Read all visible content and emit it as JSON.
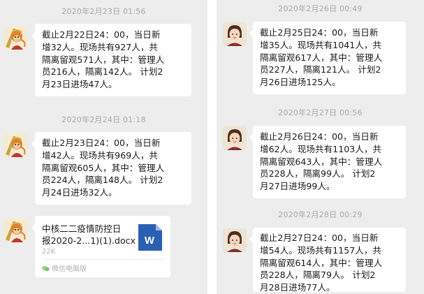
{
  "colors": {
    "chat_background": "#ededed",
    "bubble": "#ffffff",
    "timestamp_text": "#a8a8a8",
    "word_icon": "#2b5fb3"
  },
  "left_panel": {
    "messages": [
      {
        "timestamp": "2020年2月23日 01:56",
        "lines": [
          "截止2月22日24：00，当日新",
          "增32人。现场共有927人，共",
          "隔离留观571人，其中：管理人",
          "员216人，隔离142人。 计划2",
          "月23日进场47人。"
        ],
        "avatar_icon": "monkey-king-avatar-icon"
      },
      {
        "timestamp": "2020年2月24日 01:18",
        "lines": [
          "截止2月23日24：00，当日新",
          "增42人。现场共有969人，共",
          "隔离留观605人，其中：管理人",
          "员224人，隔离148人。 计划2",
          "月24日进场32人。"
        ],
        "avatar_icon": "monkey-king-avatar-icon"
      }
    ],
    "file_message": {
      "avatar_icon": "monkey-king-avatar-icon",
      "name_line1": "中核二二疫情防控日",
      "name_line2": "报2020-2...1)(1).docx",
      "size": "22K",
      "source": "微信电脑版",
      "file_icon": "word-document-icon",
      "icon_letter": "W"
    }
  },
  "right_panel": {
    "messages": [
      {
        "timestamp": "2020年2月26日 00:49",
        "lines": [
          "截止2月25日24：00，当日新",
          "增35人。现场共有1041人，共",
          "隔离留观617人，其中：管理人",
          "员227人，隔离121人。 计划2",
          "月26日进场125人。"
        ],
        "avatar_icon": "cartoon-woman-avatar-icon"
      },
      {
        "timestamp": "2020年2月27日 00:56",
        "lines": [
          "截止2月26日24：00，当日新",
          "增62人。现场共有1103人，共",
          "隔离留观643人，其中：管理人",
          "员228人，隔离99人。 计划2",
          "月27日进场99人。"
        ],
        "avatar_icon": "cartoon-woman-avatar-icon"
      },
      {
        "timestamp": "2020年2月28日 00:29",
        "lines": [
          "截止2月27日24：00，当日新",
          "增54人。现场共有1157人，共",
          "隔离留观614人，其中：管理人",
          "员228人，隔离79人。 计划2",
          "月28日进场77人。"
        ],
        "avatar_icon": "cartoon-woman-avatar-icon"
      }
    ]
  }
}
